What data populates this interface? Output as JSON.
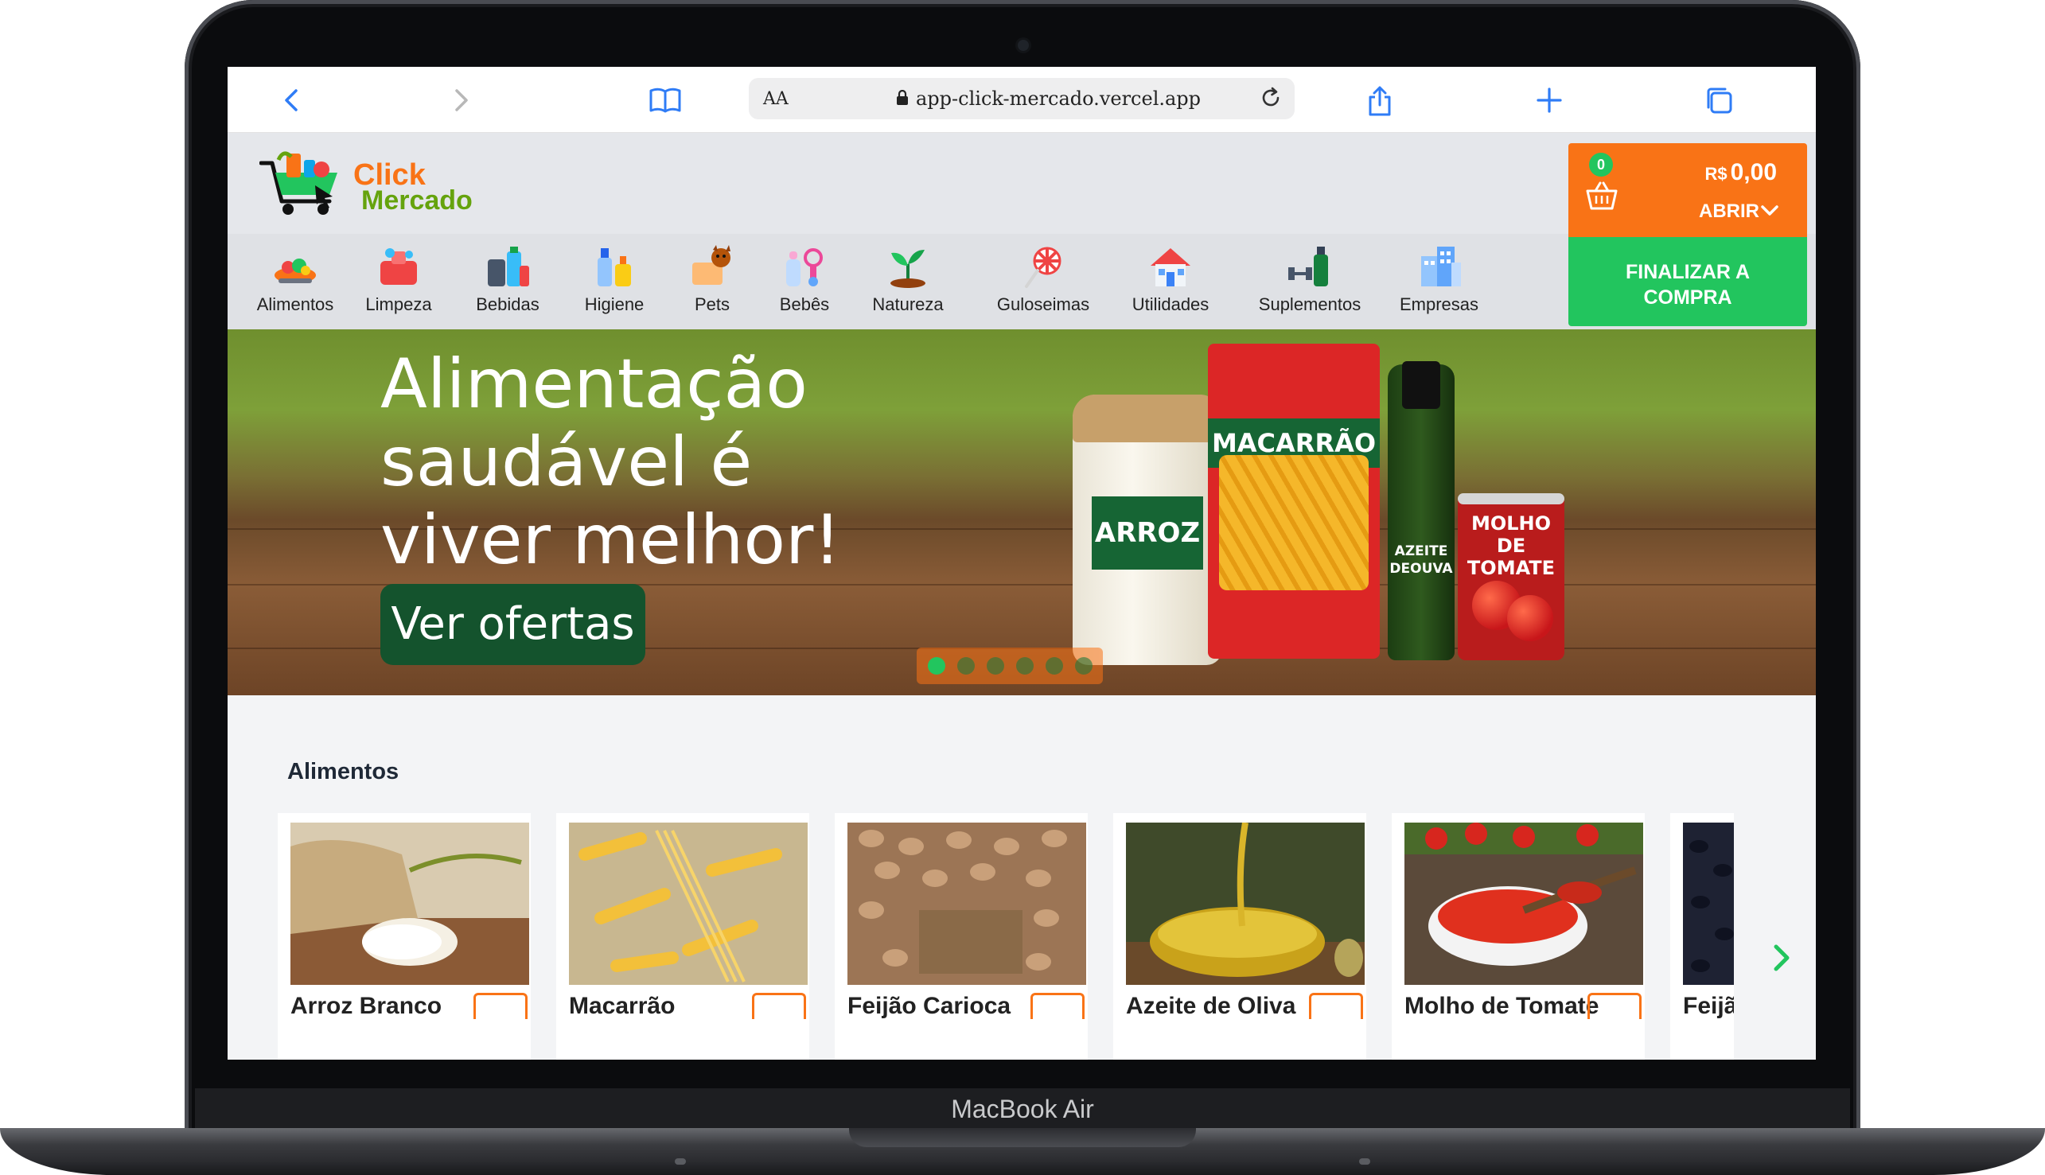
{
  "device": {
    "label": "MacBook Air"
  },
  "browser": {
    "back_icon": "chevron-left-icon",
    "forward_icon": "chevron-right-icon",
    "bookmarks_icon": "book-icon",
    "text_size_label": "AA",
    "url": "app-click-mercado.vercel.app",
    "reload_icon": "reload-icon",
    "share_icon": "share-icon",
    "new_tab_icon": "plus-icon",
    "tabs_icon": "tabs-icon"
  },
  "header": {
    "logo_line1": "Click",
    "logo_line2": "Mercado"
  },
  "categories": [
    {
      "label": "Alimentos"
    },
    {
      "label": "Limpeza"
    },
    {
      "label": "Bebidas"
    },
    {
      "label": "Higiene"
    },
    {
      "label": "Pets"
    },
    {
      "label": "Bebês"
    },
    {
      "label": "Natureza"
    },
    {
      "label": "Guloseimas"
    },
    {
      "label": "Utilidades"
    },
    {
      "label": "Suplementos"
    },
    {
      "label": "Empresas"
    }
  ],
  "cart": {
    "count": "0",
    "currency": "R$",
    "total": "0,00",
    "open_label": "ABRIR",
    "checkout_label": "FINALIZAR A COMPRA"
  },
  "hero": {
    "title": "Alimentação saudável é viver melhor!",
    "cta_label": "Ver ofertas",
    "slides": 6,
    "active_slide": 1,
    "products": {
      "rice_label": "ARROZ",
      "pasta_label": "MACARRÃO",
      "oil_label_line1": "AZEITE",
      "oil_label_line2": "DEOUVA",
      "sauce_label_line1": "MOLHO",
      "sauce_label_line2": "DE TOMATE"
    }
  },
  "section": {
    "title": "Alimentos",
    "products": [
      {
        "name": "Arroz Branco"
      },
      {
        "name": "Macarrão"
      },
      {
        "name": "Feijão Carioca"
      },
      {
        "name": "Azeite de Oliva"
      },
      {
        "name": "Molho de Tomate"
      },
      {
        "name": "Feijão"
      }
    ]
  },
  "colors": {
    "brand_orange": "#f97316",
    "brand_green": "#22c55e",
    "dark_green": "#14532d"
  }
}
